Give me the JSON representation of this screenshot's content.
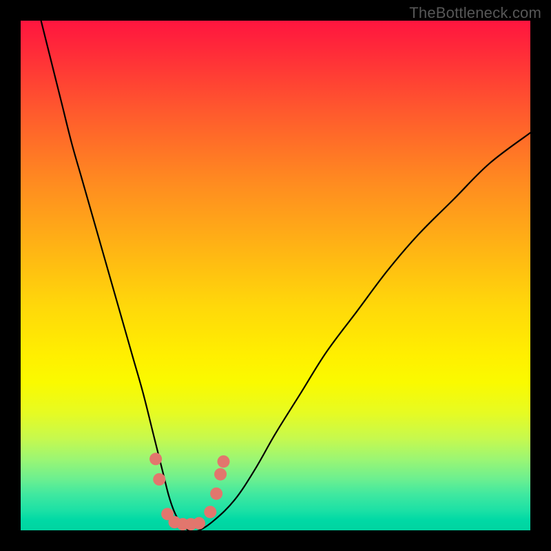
{
  "watermark": "TheBottleneck.com",
  "chart_data": {
    "type": "line",
    "title": "",
    "xlabel": "",
    "ylabel": "",
    "xlim": [
      0,
      100
    ],
    "ylim": [
      0,
      100
    ],
    "background_gradient": {
      "top": "#ff153f",
      "middle": "#fff000",
      "bottom": "#00d4a0"
    },
    "series": [
      {
        "name": "bottleneck-curve",
        "color": "#000000",
        "x": [
          4,
          6,
          8,
          10,
          12,
          14,
          16,
          18,
          20,
          22,
          24,
          26,
          27,
          28,
          29,
          30,
          31,
          32,
          33,
          35,
          38,
          42,
          46,
          50,
          55,
          60,
          66,
          72,
          78,
          85,
          92,
          100
        ],
        "y": [
          100,
          92,
          84,
          76,
          69,
          62,
          55,
          48,
          41,
          34,
          27,
          19,
          15,
          11,
          7,
          4,
          2,
          1,
          0,
          0,
          2,
          6,
          12,
          19,
          27,
          35,
          43,
          51,
          58,
          65,
          72,
          78
        ]
      }
    ],
    "markers": {
      "name": "highlight-dots",
      "color": "#e2766d",
      "radius_px": 9,
      "points": [
        {
          "x": 26.5,
          "y": 14
        },
        {
          "x": 27.2,
          "y": 10
        },
        {
          "x": 28.8,
          "y": 3.2
        },
        {
          "x": 30.2,
          "y": 1.6
        },
        {
          "x": 31.8,
          "y": 1.2
        },
        {
          "x": 33.4,
          "y": 1.2
        },
        {
          "x": 35.0,
          "y": 1.4
        },
        {
          "x": 37.2,
          "y": 3.6
        },
        {
          "x": 38.4,
          "y": 7.2
        },
        {
          "x": 39.2,
          "y": 11
        },
        {
          "x": 39.8,
          "y": 13.5
        }
      ]
    }
  }
}
